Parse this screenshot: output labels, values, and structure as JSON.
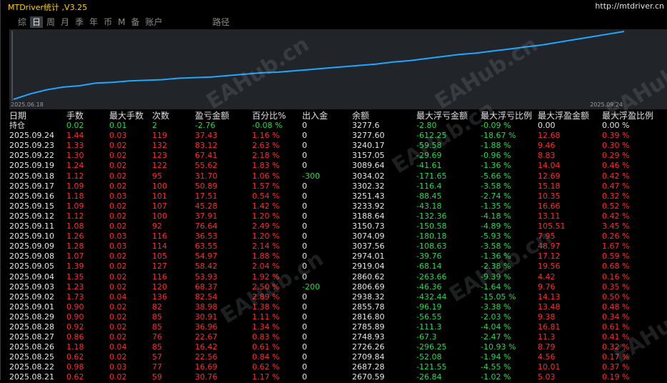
{
  "app_title": "MTDriver统计 ,V3.25",
  "site_link": "http://mtdriver.cn",
  "tabs": [
    "综",
    "日",
    "周",
    "月",
    "季",
    "年",
    "币",
    "M",
    "备",
    "账户",
    "路径"
  ],
  "active_tab": "日",
  "chart": {
    "start_date": "2025.06.18",
    "end_date": "2025.09.24",
    "line_color": "#1ea8ff"
  },
  "chart_data": {
    "type": "line",
    "x": [
      "2025.06.18",
      "2025.09.24"
    ],
    "series": [
      {
        "values": [
          0.0,
          0.08,
          0.14,
          0.18,
          0.2,
          0.24,
          0.25,
          0.27,
          0.28,
          0.29,
          0.31,
          0.32,
          0.33,
          0.35,
          0.37,
          0.39,
          0.4,
          0.42,
          0.44,
          0.46,
          0.48,
          0.5,
          0.52,
          0.55,
          0.57,
          0.6,
          0.63,
          0.66,
          0.68,
          0.71,
          0.74,
          0.77,
          0.8,
          0.84,
          0.88,
          0.92,
          0.96,
          1.0
        ]
      }
    ]
  },
  "headers": [
    "日期",
    "手数",
    "最大手数",
    "次数",
    "盈亏金额",
    "百分比%",
    "出入金",
    "余额",
    "最大浮亏金额",
    "最大浮亏比例",
    "最大浮盈金额",
    "最大浮盈比例"
  ],
  "holding": [
    "持仓",
    "0.02",
    "0.01",
    "2",
    "-2.76",
    "-0.08 %",
    "0",
    "3277.6",
    "-2.80",
    "-0.09 %",
    "0.00",
    "0.00 %"
  ],
  "rows": [
    [
      "2025.09.24",
      "1.44",
      "0.03",
      "119",
      "37.43",
      "1.16 %",
      "0",
      "3277.60",
      "-612.25",
      "-18.67 %",
      "12.68",
      "0.39 %"
    ],
    [
      "2025.09.23",
      "1.33",
      "0.02",
      "132",
      "83.12",
      "2.63 %",
      "0",
      "3240.17",
      "-59.58",
      "-1.88 %",
      "9.46",
      "0.30 %"
    ],
    [
      "2025.09.22",
      "1.30",
      "0.02",
      "123",
      "67.41",
      "2.18 %",
      "0",
      "3157.05",
      "-29.69",
      "-0.96 %",
      "8.83",
      "0.29 %"
    ],
    [
      "2025.09.19",
      "1.24",
      "0.02",
      "122",
      "55.62",
      "1.83 %",
      "0",
      "3089.64",
      "-41.61",
      "-1.36 %",
      "14.04",
      "0.46 %"
    ],
    [
      "2025.09.18",
      "1.12",
      "0.02",
      "95",
      "31.70",
      "1.06 %",
      "-300",
      "3034.02",
      "-171.65",
      "-5.66 %",
      "12.69",
      "0.42 %"
    ],
    [
      "2025.09.17",
      "1.09",
      "0.02",
      "100",
      "50.89",
      "1.57 %",
      "0",
      "3302.32",
      "-116.4",
      "-3.58 %",
      "15.18",
      "0.47 %"
    ],
    [
      "2025.09.16",
      "1.18",
      "0.03",
      "101",
      "17.51",
      "0.54 %",
      "0",
      "3251.43",
      "-88.45",
      "-2.74 %",
      "10.35",
      "0.32 %"
    ],
    [
      "2025.09.15",
      "1.09",
      "0.02",
      "107",
      "45.28",
      "1.42 %",
      "0",
      "3233.92",
      "-43.18",
      "-1.35 %",
      "16.66",
      "0.52 %"
    ],
    [
      "2025.09.12",
      "1.12",
      "0.02",
      "100",
      "37.91",
      "1.20 %",
      "0",
      "3188.64",
      "-132.36",
      "-4.18 %",
      "13.11",
      "0.42 %"
    ],
    [
      "2025.09.11",
      "1.08",
      "0.02",
      "92",
      "76.64",
      "2.49 %",
      "0",
      "3150.73",
      "-150.58",
      "-4.89 %",
      "105.51",
      "3.45 %"
    ],
    [
      "2025.09.10",
      "1.26",
      "0.03",
      "116",
      "36.53",
      "1.20 %",
      "0",
      "3074.09",
      "-180.18",
      "-5.93 %",
      "7.95",
      "0.26 %"
    ],
    [
      "2025.09.09",
      "1.28",
      "0.03",
      "114",
      "63.55",
      "2.14 %",
      "0",
      "3037.56",
      "-108.63",
      "-3.58 %",
      "48.97",
      "1.67 %"
    ],
    [
      "2025.09.08",
      "1.07",
      "0.02",
      "105",
      "54.97",
      "1.88 %",
      "0",
      "2974.01",
      "-39.76",
      "-1.36 %",
      "17.12",
      "0.59 %"
    ],
    [
      "2025.09.05",
      "1.39",
      "0.02",
      "127",
      "58.42",
      "2.04 %",
      "0",
      "2919.04",
      "-68.14",
      "-2.38 %",
      "19.56",
      "0.68 %"
    ],
    [
      "2025.09.04",
      "1.35",
      "0.02",
      "116",
      "53.93",
      "1.92 %",
      "0",
      "2860.62",
      "-263.66",
      "-9.39 %",
      "4.42",
      "0.16 %"
    ],
    [
      "2025.09.03",
      "1.23",
      "0.02",
      "120",
      "68.37",
      "2.50 %",
      "-200",
      "2806.69",
      "-46.36",
      "-1.64 %",
      "9.76",
      "0.35 %"
    ],
    [
      "2025.09.02",
      "1.73",
      "0.04",
      "136",
      "82.54",
      "2.89 %",
      "0",
      "2938.32",
      "-432.44",
      "-15.05 %",
      "14.13",
      "0.50 %"
    ],
    [
      "2025.09.01",
      "0.90",
      "0.02",
      "82",
      "38.98",
      "1.38 %",
      "0",
      "2855.78",
      "-96.19",
      "-3.38 %",
      "13.48",
      "0.48 %"
    ],
    [
      "2025.08.29",
      "0.90",
      "0.02",
      "85",
      "30.91",
      "1.11 %",
      "0",
      "2816.80",
      "-56.55",
      "-2.03 %",
      "9.38",
      "0.34 %"
    ],
    [
      "2025.08.28",
      "0.92",
      "0.02",
      "85",
      "36.96",
      "1.34 %",
      "0",
      "2785.89",
      "-111.3",
      "-4.04 %",
      "16.81",
      "0.61 %"
    ],
    [
      "2025.08.27",
      "0.86",
      "0.02",
      "76",
      "22.67",
      "0.83 %",
      "0",
      "2748.93",
      "-67.3",
      "-2.47 %",
      "11.3",
      "0.41 %"
    ],
    [
      "2025.08.26",
      "1.18",
      "0.04",
      "85",
      "16.42",
      "0.61 %",
      "0",
      "2726.26",
      "-296.25",
      "-10.93 %",
      "8.79",
      "0.32 %"
    ],
    [
      "2025.08.25",
      "0.62",
      "0.02",
      "57",
      "22.56",
      "0.84 %",
      "0",
      "2709.84",
      "-52.08",
      "-1.94 %",
      "4.56",
      "0.17 %"
    ],
    [
      "2025.08.22",
      "0.98",
      "0.03",
      "77",
      "16.69",
      "0.62 %",
      "0",
      "2687.28",
      "-121.55",
      "-4.55 %",
      "10.01",
      "0.37 %"
    ],
    [
      "2025.08.21",
      "0.62",
      "0.02",
      "59",
      "30.76",
      "1.17 %",
      "0",
      "2670.59",
      "-26.84",
      "-1.02 %",
      "5.03",
      "0.19 %"
    ]
  ],
  "watermark_text": "EAHub.cn"
}
